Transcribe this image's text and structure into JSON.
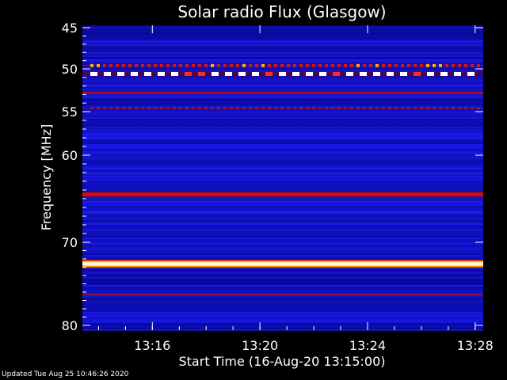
{
  "chart_data": {
    "type": "heatmap",
    "title": "Solar radio Flux (Glasgow)",
    "xlabel": "Start Time (16-Aug-20 13:15:00)",
    "ylabel": "Frequency [MHz]",
    "x_range": [
      "13:15",
      "13:30"
    ],
    "xlim_minutes": [
      13.4,
      28.3
    ],
    "x_ticks": [
      {
        "label": "13:16",
        "minute": 16
      },
      {
        "label": "13:20",
        "minute": 20
      },
      {
        "label": "13:24",
        "minute": 24
      },
      {
        "label": "13:28",
        "minute": 28
      }
    ],
    "ylim": [
      45,
      80
    ],
    "y_ticks": [
      45,
      50,
      55,
      60,
      70,
      80
    ],
    "y_scale": "nonlinear (frequency increasing downward)",
    "features": [
      {
        "frequency_mhz": 49.6,
        "kind": "intermittent",
        "intensity": "high"
      },
      {
        "frequency_mhz": 50.6,
        "kind": "intermittent",
        "intensity": "saturated"
      },
      {
        "frequency_mhz": 52.8,
        "kind": "continuous",
        "intensity": "moderate"
      },
      {
        "frequency_mhz": 54.6,
        "kind": "intermittent",
        "intensity": "moderate"
      },
      {
        "frequency_mhz": 64.5,
        "kind": "continuous",
        "intensity": "high"
      },
      {
        "frequency_mhz": 72.6,
        "kind": "continuous",
        "intensity": "saturated"
      },
      {
        "frequency_mhz": 76.3,
        "kind": "continuous",
        "intensity": "low"
      }
    ],
    "colormap": [
      "#000080",
      "#1010ff",
      "#c00000",
      "#ff2000",
      "#ffd000",
      "#ffffff"
    ],
    "background_color": "#000000",
    "text_color": "#ffffff"
  },
  "footer": {
    "updated": "Updated Tue Aug 25 10:46:26 2020"
  }
}
